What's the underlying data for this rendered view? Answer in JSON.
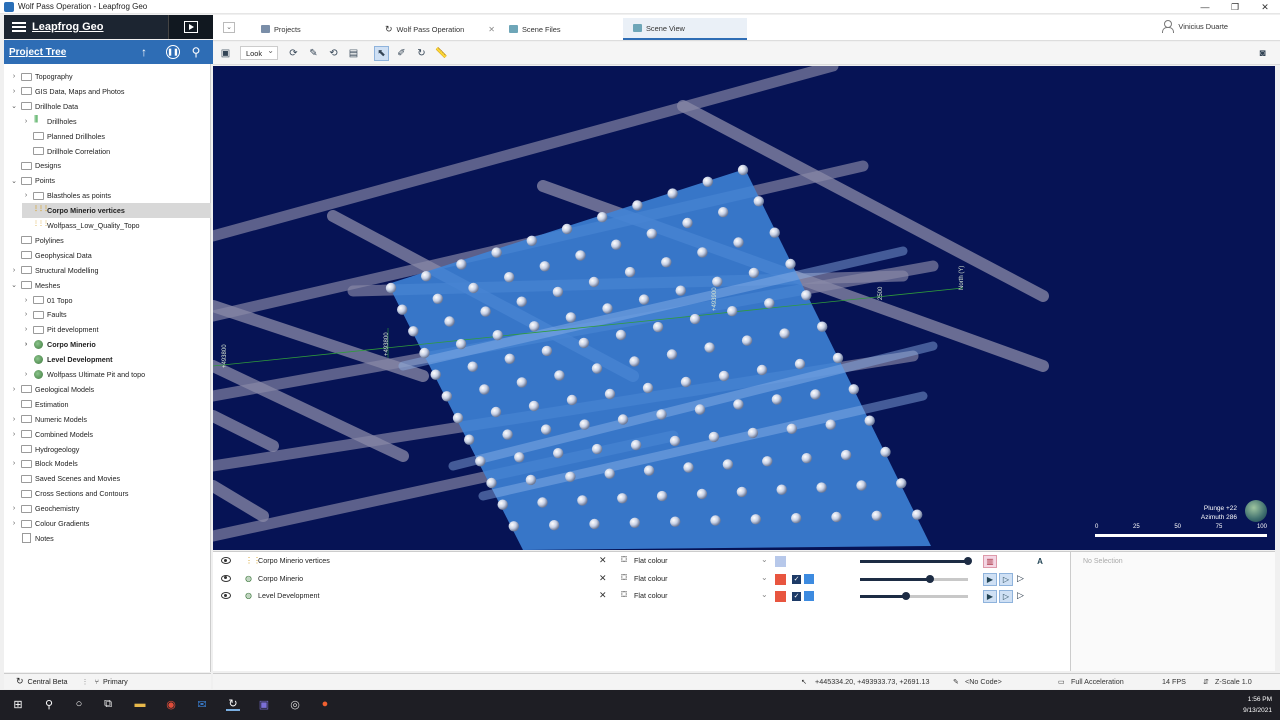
{
  "window": {
    "title": "Wolf Pass Operation - Leapfrog Geo"
  },
  "app": {
    "name": "Leapfrog Geo"
  },
  "project_tree": {
    "title": "Project Tree",
    "items": [
      {
        "label": "Topography",
        "level": 0,
        "chevron": "right"
      },
      {
        "label": "GIS Data, Maps and Photos",
        "level": 0,
        "chevron": "right"
      },
      {
        "label": "Drillhole Data",
        "level": 0,
        "chevron": "down"
      },
      {
        "label": "Drillholes",
        "level": 1,
        "chevron": "right",
        "icon": "drillholes"
      },
      {
        "label": "Planned Drillholes",
        "level": 1,
        "chevron": ""
      },
      {
        "label": "Drillhole Correlation",
        "level": 1,
        "chevron": ""
      },
      {
        "label": "Designs",
        "level": 0,
        "chevron": ""
      },
      {
        "label": "Points",
        "level": 0,
        "chevron": "down"
      },
      {
        "label": "Blastholes as points",
        "level": 1,
        "chevron": "right"
      },
      {
        "label": "Corpo Minerio vertices",
        "level": 1,
        "chevron": "",
        "icon": "points",
        "bold": true,
        "selected": true
      },
      {
        "label": "Wolfpass_Low_Quality_Topo",
        "level": 1,
        "chevron": "",
        "icon": "points"
      },
      {
        "label": "Polylines",
        "level": 0,
        "chevron": ""
      },
      {
        "label": "Geophysical Data",
        "level": 0,
        "chevron": ""
      },
      {
        "label": "Structural Modelling",
        "level": 0,
        "chevron": "right"
      },
      {
        "label": "Meshes",
        "level": 0,
        "chevron": "down"
      },
      {
        "label": "01 Topo",
        "level": 1,
        "chevron": "right"
      },
      {
        "label": "Faults",
        "level": 1,
        "chevron": "right"
      },
      {
        "label": "Pit development",
        "level": 1,
        "chevron": "right"
      },
      {
        "label": "Corpo Minerio",
        "level": 1,
        "chevron": "right",
        "icon": "mesh",
        "bold": true
      },
      {
        "label": "Level Development",
        "level": 1,
        "chevron": "",
        "icon": "mesh",
        "bold": true
      },
      {
        "label": "Wolfpass Ultimate Pit and topo",
        "level": 1,
        "chevron": "right",
        "icon": "mesh"
      },
      {
        "label": "Geological Models",
        "level": 0,
        "chevron": "right"
      },
      {
        "label": "Estimation",
        "level": 0,
        "chevron": ""
      },
      {
        "label": "Numeric Models",
        "level": 0,
        "chevron": "right"
      },
      {
        "label": "Combined Models",
        "level": 0,
        "chevron": "right"
      },
      {
        "label": "Hydrogeology",
        "level": 0,
        "chevron": ""
      },
      {
        "label": "Block Models",
        "level": 0,
        "chevron": "right"
      },
      {
        "label": "Saved Scenes and Movies",
        "level": 0,
        "chevron": ""
      },
      {
        "label": "Cross Sections and Contours",
        "level": 0,
        "chevron": ""
      },
      {
        "label": "Geochemistry",
        "level": 0,
        "chevron": "right"
      },
      {
        "label": "Colour Gradients",
        "level": 0,
        "chevron": "right"
      },
      {
        "label": "Notes",
        "level": 0,
        "chevron": "",
        "icon": "note"
      }
    ]
  },
  "tabs": [
    {
      "label": "Projects",
      "color": "#7a8ea8"
    },
    {
      "label": "Wolf Pass Operation",
      "color": "#444444"
    },
    {
      "label": "Scene Files",
      "color": "#6ea6b8"
    },
    {
      "label": "Scene View",
      "color": "#6ea6b8",
      "active": true
    }
  ],
  "user": {
    "name": "Vinicius Duarte"
  },
  "toolbar": {
    "look_label": "Look"
  },
  "scene": {
    "background": "#061355",
    "plane_color": "#3f84d8",
    "plunge": "Plunge +22",
    "azimuth": "Azimuth 286",
    "scale_ticks": [
      "0",
      "25",
      "50",
      "75",
      "100"
    ],
    "axis_labels": [
      "+493800",
      "+493900",
      "+2700",
      "North (Y)",
      "2500"
    ]
  },
  "layers": [
    {
      "name": "Corpo Minerio vertices",
      "mode": "Flat colour",
      "swatch": "#b7c8ea",
      "opacity": 100,
      "icon": "points"
    },
    {
      "name": "Corpo Minerio",
      "mode": "Flat colour",
      "swatch": "#e8553f",
      "opacity": 65,
      "icon": "mesh"
    },
    {
      "name": "Level Development",
      "mode": "Flat colour",
      "swatch": "#e8553f",
      "opacity": 43,
      "icon": "mesh"
    }
  ],
  "selection_panel": {
    "label": "No Selection"
  },
  "status": {
    "left_name": "Central Beta",
    "left_branch": "Primary",
    "coordinates": "+445334.20, +493933.73, +2691.13",
    "code": "<No Code>",
    "acceleration": "Full Acceleration",
    "fps": "14 FPS",
    "zscale": "Z-Scale 1.0"
  },
  "taskbar": {
    "time": "1:56 PM",
    "date": "9/13/2021"
  }
}
